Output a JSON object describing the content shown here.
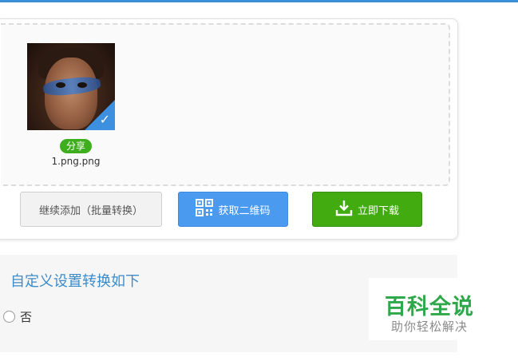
{
  "colors": {
    "accent": "#3b8fd9",
    "qrcode_button": "#4a9af0",
    "download_button": "#42ab10",
    "share_badge": "#3fae1e",
    "settings_title": "#3d8bc9",
    "watermark": "#2ea84a"
  },
  "upload": {
    "file": {
      "share_label": "分享",
      "name": "1.png.png",
      "selected": true
    }
  },
  "actions": {
    "continue_label": "继续添加（批量转换）",
    "qrcode_label": "获取二维码",
    "download_label": "立即下载",
    "qrcode_icon": "qrcode-icon",
    "download_icon": "download-icon"
  },
  "settings": {
    "title": "自定义设置转换如下",
    "option_no": "否"
  },
  "watermark": {
    "title": "百科全说",
    "subtitle": "助你轻松解决"
  }
}
